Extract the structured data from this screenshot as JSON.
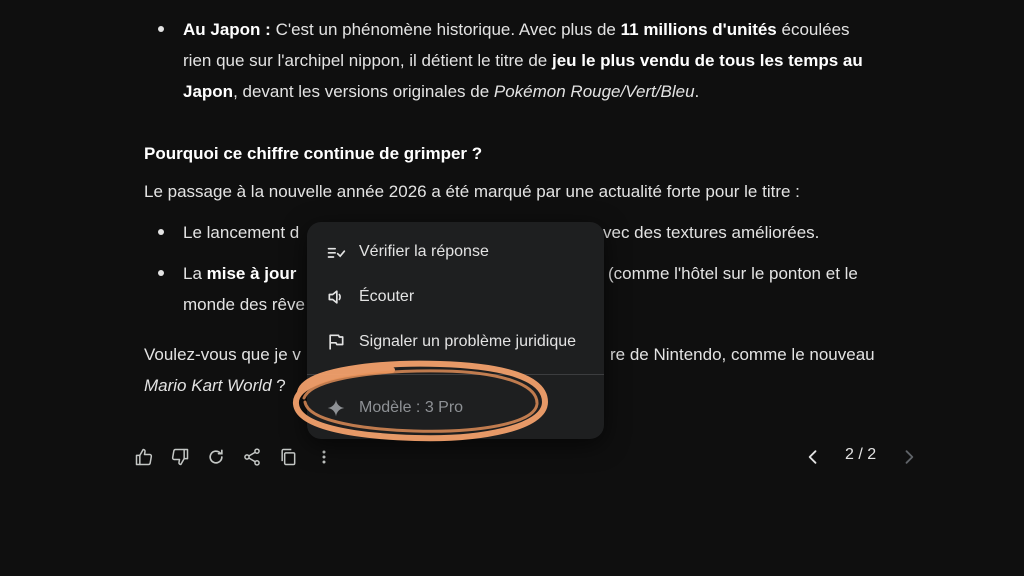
{
  "content": {
    "bullet1": {
      "label": "Au Japon :",
      "t1": " C'est un phénomène historique. Avec plus de ",
      "b1": "11 millions d'unités",
      "t2": " écoulées",
      "line2a": "rien que sur l'archipel nippon, il détient le titre de ",
      "line2b": "jeu le plus vendu de tous les temps au",
      "line3a": "Japon",
      "line3b": ", devant les versions originales de ",
      "line3c": "Pokémon Rouge/Vert/Bleu",
      "line3d": "."
    },
    "heading": "Pourquoi ce chiffre continue de grimper ?",
    "intro": "Le passage à la nouvelle année 2026 a été marqué par une actualité forte pour le titre :",
    "bullet2": {
      "start": "Le lancement d",
      "end": "vec des textures améliorées."
    },
    "bullet3": {
      "start": "La ",
      "bold": "mise à jour",
      "end": "(comme l'hôtel sur le ponton et le",
      "line2": "monde des rêve"
    },
    "question": {
      "start": "Voulez-vous que je v",
      "end": "re de Nintendo, comme le nouveau",
      "line2a": "Mario Kart World",
      "line2b": " ?"
    }
  },
  "menu": {
    "items": [
      {
        "label": "Vérifier la réponse",
        "icon": "double-check-icon"
      },
      {
        "label": "Écouter",
        "icon": "speaker-icon"
      },
      {
        "label": "Signaler un problème juridique",
        "icon": "flag-icon"
      }
    ],
    "model_label": "Modèle : 3 Pro",
    "model_icon": "sparkle-icon"
  },
  "toolbar": {
    "icons": [
      "thumb-up-icon",
      "thumb-down-icon",
      "regenerate-icon",
      "share-icon",
      "copy-icon",
      "more-vert-icon"
    ]
  },
  "pager": {
    "label": "2 / 2"
  },
  "colors": {
    "background": "#0f0f0f",
    "menu_bg": "#1e1f20",
    "annotation": "#f2a06b"
  }
}
